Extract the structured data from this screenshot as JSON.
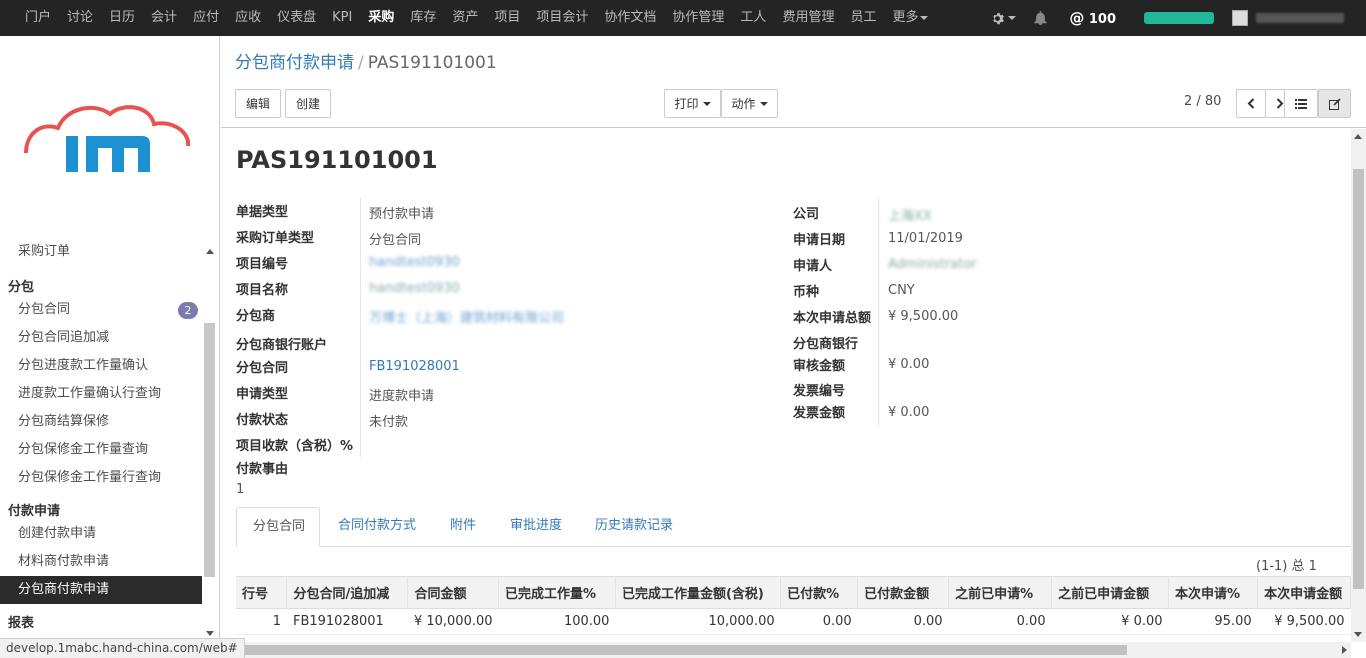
{
  "topnav": {
    "items": [
      "门户",
      "讨论",
      "日历",
      "会计",
      "应付",
      "应收",
      "仪表盘",
      "KPI",
      "采购",
      "库存",
      "资产",
      "项目",
      "项目会计",
      "协作文档",
      "协作管理",
      "工人",
      "费用管理",
      "员工",
      "更多"
    ],
    "active": "采购",
    "credit": "100",
    "credit_symbol": "@",
    "progress_color": "#21b799"
  },
  "sidebar": {
    "items": [
      {
        "label": "采购订单",
        "type": "item"
      },
      {
        "label": "分包",
        "type": "head"
      },
      {
        "label": "分包合同",
        "type": "item",
        "badge": "2"
      },
      {
        "label": "分包合同追加减",
        "type": "item"
      },
      {
        "label": "分包进度款工作量确认",
        "type": "item"
      },
      {
        "label": "进度款工作量确认行查询",
        "type": "item"
      },
      {
        "label": "分包商结算保修",
        "type": "item"
      },
      {
        "label": "分包保修金工作量查询",
        "type": "item"
      },
      {
        "label": "分包保修金工作量行查询",
        "type": "item"
      },
      {
        "label": "付款申请",
        "type": "head"
      },
      {
        "label": "创建付款申请",
        "type": "item"
      },
      {
        "label": "材料商付款申请",
        "type": "item"
      },
      {
        "label": "分包商付款申请",
        "type": "item",
        "active": true
      },
      {
        "label": "报表",
        "type": "head"
      }
    ]
  },
  "control": {
    "breadcrumb_parent": "分包商付款申请",
    "breadcrumb_sep": "/",
    "breadcrumb_current": "PAS191101001",
    "edit_label": "编辑",
    "create_label": "创建",
    "print_label": "打印",
    "action_label": "动作",
    "pager": "2 / 80"
  },
  "form": {
    "title": "PAS191101001",
    "left_fields": [
      {
        "label": "单据类型",
        "value": "预付款申请"
      },
      {
        "label": "采购订单类型",
        "value": "分包合同"
      },
      {
        "label": "项目编号",
        "value": "handtest0930",
        "blur": true,
        "link": true
      },
      {
        "label": "项目名称",
        "value": "handtest0930",
        "blur": true
      },
      {
        "label": "分包商",
        "value": "万博士（上海）建筑材料有限公司",
        "blur": true,
        "link": true
      },
      {
        "label": "分包商银行账户",
        "value": ""
      },
      {
        "label": "分包合同",
        "value": "FB191028001",
        "link": true
      },
      {
        "label": "申请类型",
        "value": "进度款申请"
      },
      {
        "label": "付款状态",
        "value": "未付款"
      },
      {
        "label": "项目收款（含税）%",
        "value": ""
      },
      {
        "label": "付款事由",
        "value": ""
      }
    ],
    "reason_value": "1",
    "right_fields": [
      {
        "label": "公司",
        "value": "上海XX",
        "blur": true
      },
      {
        "label": "申请日期",
        "value": "11/01/2019"
      },
      {
        "label": "申请人",
        "value": "Administrator",
        "blur": true
      },
      {
        "label": "币种",
        "value": "CNY"
      },
      {
        "label": "本次申请总额",
        "value": "¥ 9,500.00"
      },
      {
        "label": "分包商银行",
        "value": ""
      },
      {
        "label": "审核金额",
        "value": "¥ 0.00"
      },
      {
        "label": "发票编号",
        "value": ""
      },
      {
        "label": "发票金额",
        "value": "¥ 0.00"
      }
    ],
    "tabs": [
      "分包合同",
      "合同付款方式",
      "附件",
      "审批进度",
      "历史请款记录"
    ],
    "active_tab": "分包合同",
    "list_pager": "(1-1) 总 1",
    "table": {
      "columns": [
        "行号",
        "分包合同/追加减",
        "合同金额",
        "已完成工作量%",
        "已完成工作量金额(含税)",
        "已付款%",
        "已付款金额",
        "之前已申请%",
        "之前已申请金额",
        "本次申请%",
        "本次申请金额"
      ],
      "rows": [
        [
          "1",
          "FB191028001",
          "¥ 10,000.00",
          "100.00",
          "10,000.00",
          "0.00",
          "0.00",
          "0.00",
          "¥ 0.00",
          "95.00",
          "¥ 9,500.00"
        ]
      ]
    }
  },
  "status_url": "develop.1mabc.hand-china.com/web#"
}
